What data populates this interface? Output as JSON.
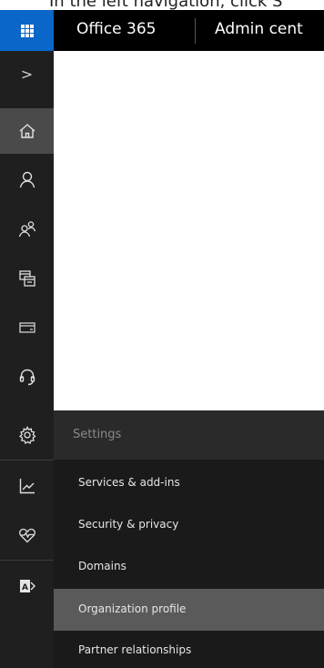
{
  "caption": {
    "text": "In the left navigation, click S"
  },
  "topbar": {
    "brand": "Office 365",
    "title": "Admin cent"
  },
  "rail": {
    "items": [
      {
        "icon": "expand-chevron-icon",
        "glyph": ">"
      },
      {
        "icon": "home-icon"
      },
      {
        "icon": "user-icon"
      },
      {
        "icon": "groups-icon"
      },
      {
        "icon": "resources-icon"
      },
      {
        "icon": "billing-icon"
      },
      {
        "icon": "support-icon"
      },
      {
        "icon": "settings-icon"
      },
      {
        "icon": "reports-icon"
      },
      {
        "icon": "health-icon"
      },
      {
        "icon": "admin-centers-icon"
      }
    ]
  },
  "settings": {
    "header": "Settings",
    "items": [
      {
        "label": "Services & add-ins",
        "active": false
      },
      {
        "label": "Security & privacy",
        "active": false
      },
      {
        "label": "Domains",
        "active": false
      },
      {
        "label": "Organization profile",
        "active": true
      },
      {
        "label": "Partner relationships",
        "active": false
      }
    ]
  },
  "colors": {
    "app_launcher": "#0a66c7",
    "topbar": "#000000",
    "rail": "#1f1f1f",
    "rail_active": "#4a4a4a",
    "submenu": "#1a1a1a",
    "submenu_active": "#5a5a5a"
  }
}
